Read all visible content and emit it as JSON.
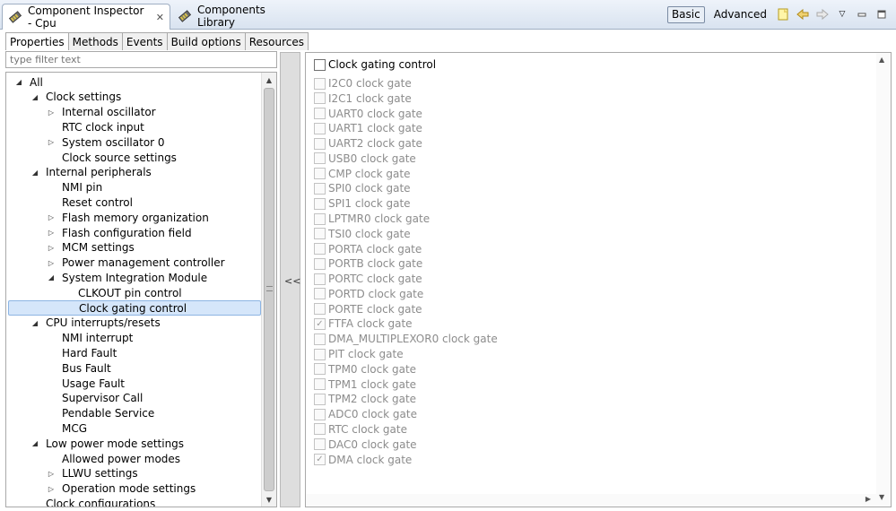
{
  "view_tabs": [
    {
      "label": "Component Inspector - Cpu",
      "icon": "component-icon"
    },
    {
      "label": "Components Library",
      "icon": "component-icon"
    }
  ],
  "toolbar": {
    "basic_label": "Basic",
    "advanced_label": "Advanced",
    "icons": [
      "new-note-icon",
      "back-arrow-icon",
      "forward-arrow-icon",
      "view-menu-icon",
      "minimize-icon",
      "maximize-icon"
    ]
  },
  "sub_tabs": [
    "Properties",
    "Methods",
    "Events",
    "Build options",
    "Resources"
  ],
  "filter": {
    "placeholder": "type filter text"
  },
  "tree": [
    {
      "label": "All",
      "level": 0,
      "state": "expanded"
    },
    {
      "label": "Clock settings",
      "level": 1,
      "state": "expanded"
    },
    {
      "label": "Internal oscillator",
      "level": 2,
      "state": "collapsed"
    },
    {
      "label": "RTC clock input",
      "level": 2,
      "state": "leaf"
    },
    {
      "label": "System oscillator 0",
      "level": 2,
      "state": "collapsed"
    },
    {
      "label": "Clock source settings",
      "level": 2,
      "state": "leaf"
    },
    {
      "label": "Internal peripherals",
      "level": 1,
      "state": "expanded"
    },
    {
      "label": "NMI pin",
      "level": 2,
      "state": "leaf"
    },
    {
      "label": "Reset control",
      "level": 2,
      "state": "leaf"
    },
    {
      "label": "Flash memory organization",
      "level": 2,
      "state": "collapsed"
    },
    {
      "label": "Flash configuration field",
      "level": 2,
      "state": "collapsed"
    },
    {
      "label": "MCM settings",
      "level": 2,
      "state": "collapsed"
    },
    {
      "label": "Power management controller",
      "level": 2,
      "state": "collapsed"
    },
    {
      "label": "System Integration Module",
      "level": 2,
      "state": "expanded"
    },
    {
      "label": "CLKOUT pin control",
      "level": 3,
      "state": "leaf"
    },
    {
      "label": "Clock gating control",
      "level": 3,
      "state": "leaf",
      "selected": true
    },
    {
      "label": "CPU interrupts/resets",
      "level": 1,
      "state": "expanded"
    },
    {
      "label": "NMI interrupt",
      "level": 2,
      "state": "leaf"
    },
    {
      "label": "Hard Fault",
      "level": 2,
      "state": "leaf"
    },
    {
      "label": "Bus Fault",
      "level": 2,
      "state": "leaf"
    },
    {
      "label": "Usage Fault",
      "level": 2,
      "state": "leaf"
    },
    {
      "label": "Supervisor Call",
      "level": 2,
      "state": "leaf"
    },
    {
      "label": "Pendable Service",
      "level": 2,
      "state": "leaf"
    },
    {
      "label": "MCG",
      "level": 2,
      "state": "leaf"
    },
    {
      "label": "Low power mode settings",
      "level": 1,
      "state": "expanded"
    },
    {
      "label": "Allowed power modes",
      "level": 2,
      "state": "leaf"
    },
    {
      "label": "LLWU settings",
      "level": 2,
      "state": "collapsed"
    },
    {
      "label": "Operation mode settings",
      "level": 2,
      "state": "collapsed"
    },
    {
      "label": "Clock configurations",
      "level": 1,
      "state": "leaf"
    }
  ],
  "splitter": {
    "label": "<<"
  },
  "detail": {
    "main_label": "Clock gating control",
    "main_checked": false,
    "gates": [
      {
        "label": "I2C0 clock gate",
        "checked": false
      },
      {
        "label": "I2C1 clock gate",
        "checked": false
      },
      {
        "label": "UART0 clock gate",
        "checked": false
      },
      {
        "label": "UART1 clock gate",
        "checked": false
      },
      {
        "label": "UART2 clock gate",
        "checked": false
      },
      {
        "label": "USB0 clock gate",
        "checked": false
      },
      {
        "label": "CMP clock gate",
        "checked": false
      },
      {
        "label": "SPI0 clock gate",
        "checked": false
      },
      {
        "label": "SPI1 clock gate",
        "checked": false
      },
      {
        "label": "LPTMR0 clock gate",
        "checked": false
      },
      {
        "label": "TSI0 clock gate",
        "checked": false
      },
      {
        "label": "PORTA clock gate",
        "checked": false
      },
      {
        "label": "PORTB clock gate",
        "checked": false
      },
      {
        "label": "PORTC clock gate",
        "checked": false
      },
      {
        "label": "PORTD clock gate",
        "checked": false
      },
      {
        "label": "PORTE clock gate",
        "checked": false
      },
      {
        "label": "FTFA clock gate",
        "checked": true
      },
      {
        "label": "DMA_MULTIPLEXOR0 clock gate",
        "checked": false
      },
      {
        "label": "PIT clock gate",
        "checked": false
      },
      {
        "label": "TPM0 clock gate",
        "checked": false
      },
      {
        "label": "TPM1 clock gate",
        "checked": false
      },
      {
        "label": "TPM2 clock gate",
        "checked": false
      },
      {
        "label": "ADC0 clock gate",
        "checked": false
      },
      {
        "label": "RTC clock gate",
        "checked": false
      },
      {
        "label": "DAC0 clock gate",
        "checked": false
      },
      {
        "label": "DMA clock gate",
        "checked": true
      }
    ]
  }
}
